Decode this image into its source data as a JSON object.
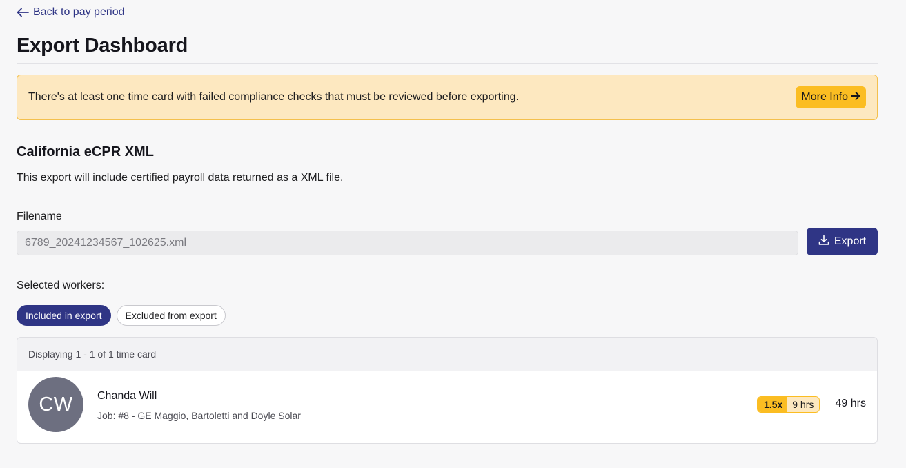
{
  "nav": {
    "back_label": "Back to pay period"
  },
  "page": {
    "title": "Export Dashboard"
  },
  "alert": {
    "message": "There's at least one time card with failed compliance checks that must be reviewed before exporting.",
    "button_label": "More Info"
  },
  "export": {
    "title": "California eCPR XML",
    "description": "This export will include certified payroll data returned as a XML file.",
    "filename_label": "Filename",
    "filename_value": "6789_20241234567_102625.xml",
    "button_label": "Export"
  },
  "workers": {
    "label": "Selected workers:",
    "tabs": [
      {
        "label": "Included in export",
        "active": true
      },
      {
        "label": "Excluded from export",
        "active": false
      }
    ],
    "display_text": "Displaying 1 - 1 of 1 time card",
    "items": [
      {
        "initials": "CW",
        "name": "Chanda Will",
        "job": "Job: #8 - GE Maggio, Bartoletti and Doyle Solar",
        "rate_multiplier": "1.5x",
        "rate_hours": "9 hrs",
        "total_hours": "49 hrs"
      }
    ]
  },
  "colors": {
    "primary": "#2f3585",
    "warning": "#fbbd22",
    "warning_bg": "#fde8c0",
    "avatar": "#6d6f80"
  }
}
